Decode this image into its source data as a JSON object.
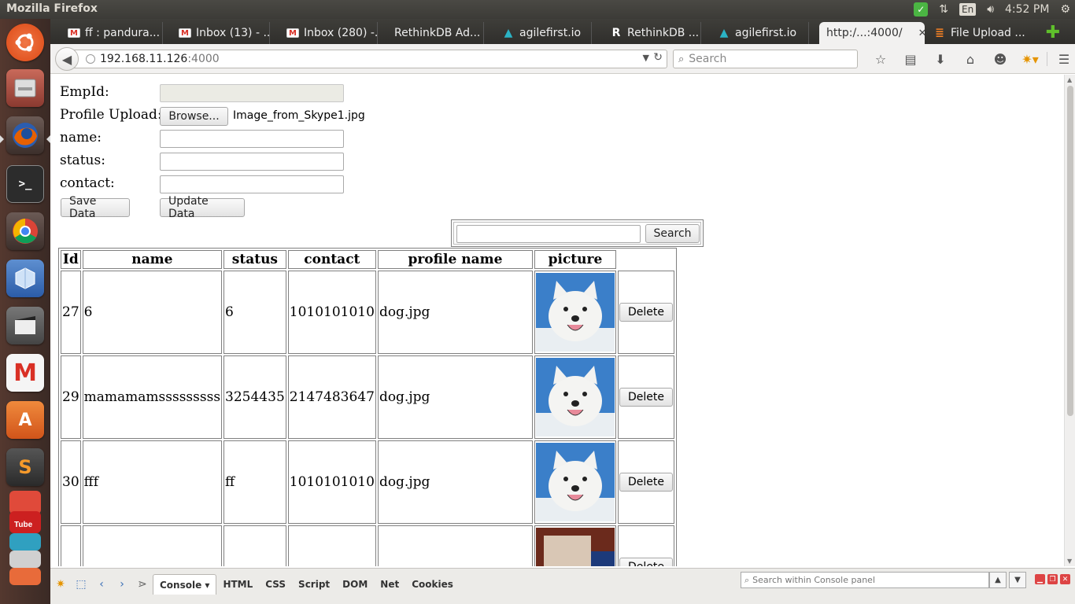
{
  "os_panel": {
    "app_title": "Mozilla Firefox",
    "keyboard_lang": "En",
    "clock": "4:52 PM"
  },
  "launcher": {
    "items": [
      "files",
      "firefox",
      "terminal",
      "chrome",
      "virtualbox",
      "video-editor",
      "gmail",
      "software-center",
      "sublime-text",
      "stacked-apps"
    ]
  },
  "tabs": [
    {
      "label": "ff : pandura...",
      "icon": "gmail"
    },
    {
      "label": "Inbox (13) - ...",
      "icon": "gmail"
    },
    {
      "label": "Inbox (280) -...",
      "icon": "gmail"
    },
    {
      "label": "RethinkDB Ad...",
      "icon": "none"
    },
    {
      "label": "agilefirst.io",
      "icon": "agile"
    },
    {
      "label": "RethinkDB ...",
      "icon": "rethinkdb"
    },
    {
      "label": "agilefirst.io",
      "icon": "agile"
    },
    {
      "label": "http:/...:4000/",
      "icon": "none",
      "active": true
    },
    {
      "label": "File Upload ...",
      "icon": "stackoverflow"
    }
  ],
  "navbar": {
    "url_host": "192.168.11.126",
    "url_port": ":4000",
    "search_placeholder": "Search"
  },
  "form": {
    "empid_label": "EmpId:",
    "profile_label": "Profile Upload:",
    "browse_label": "Browse...",
    "file_name": "Image_from_Skype1.jpg",
    "name_label": "name:",
    "status_label": "status:",
    "contact_label": "contact:",
    "save_label": "Save Data",
    "update_label": "Update Data",
    "search_label": "Search"
  },
  "table": {
    "headers": [
      "Id",
      "name",
      "status",
      "contact",
      "profile name",
      "picture"
    ],
    "delete_label": "Delete",
    "rows": [
      {
        "id": "27",
        "name": "6",
        "status": "6",
        "contact": "1010101010",
        "profile": "dog.jpg"
      },
      {
        "id": "29",
        "name": "mamamamsssssssss",
        "status": "3254435",
        "contact": "2147483647",
        "profile": "dog.jpg"
      },
      {
        "id": "30",
        "name": "fff",
        "status": "ff",
        "contact": "1010101010",
        "profile": "dog.jpg"
      }
    ]
  },
  "firebug": {
    "tabs": [
      "Console",
      "HTML",
      "CSS",
      "Script",
      "DOM",
      "Net",
      "Cookies"
    ],
    "search_placeholder": "Search within Console panel"
  }
}
